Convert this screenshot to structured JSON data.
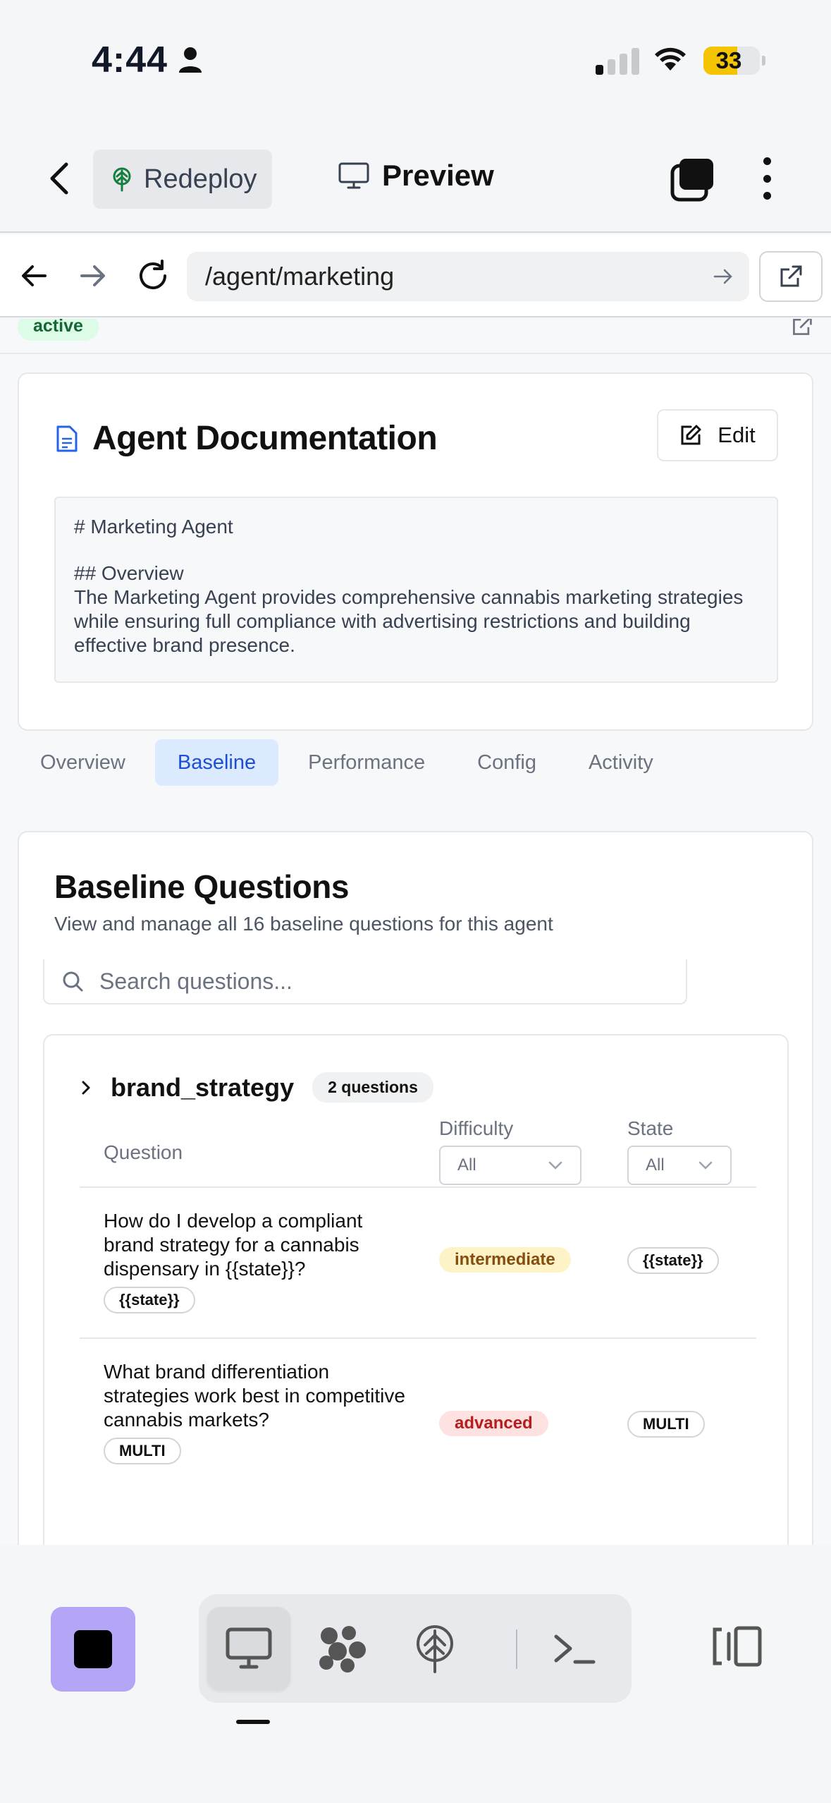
{
  "status_bar": {
    "time": "4:44",
    "battery": "33"
  },
  "app_header": {
    "redeploy_label": "Redeploy",
    "preview_label": "Preview"
  },
  "browser": {
    "url": "/agent/marketing"
  },
  "agent": {
    "status_badge": "active"
  },
  "documentation": {
    "title": "Agent Documentation",
    "edit_label": "Edit",
    "line1": "# Marketing Agent",
    "line2": "## Overview",
    "line3": "The Marketing Agent provides comprehensive cannabis marketing strategies while ensuring full compliance with advertising restrictions and building effective brand presence."
  },
  "tabs": [
    {
      "label": "Overview"
    },
    {
      "label": "Baseline"
    },
    {
      "label": "Performance"
    },
    {
      "label": "Config"
    },
    {
      "label": "Activity"
    }
  ],
  "active_tab": "Baseline",
  "baseline": {
    "title": "Baseline Questions",
    "subtitle": "View and manage all 16 baseline questions for this agent",
    "search_placeholder": "Search questions...",
    "group": {
      "name": "brand_strategy",
      "count_label": "2 questions",
      "columns": {
        "question": "Question",
        "difficulty": "Difficulty",
        "state": "State"
      },
      "filters": {
        "difficulty": "All",
        "state": "All"
      },
      "rows": [
        {
          "question": "How do I develop a compliant brand strategy for a cannabis dispensary in {{state}}?",
          "tag": "{{state}}",
          "difficulty": "intermediate",
          "state": "{{state}}"
        },
        {
          "question": "What brand differentiation strategies work best in competitive cannabis markets?",
          "tag": "MULTI",
          "difficulty": "advanced",
          "state": "MULTI"
        }
      ]
    }
  },
  "colors": {
    "accent_tab_bg": "#dbeafe",
    "accent_tab_text": "#1d4ed8",
    "intermediate_bg": "#fef3c7",
    "advanced_bg": "#fee2e2",
    "active_badge_bg": "#dcfce7",
    "stop_button": "#b4a5f7",
    "battery": "#f5c400"
  },
  "icons": [
    "person-icon",
    "signal-icon",
    "wifi-icon",
    "back-chevron-icon",
    "deploy-tree-icon",
    "monitor-icon",
    "layers-icon",
    "more-vertical-icon",
    "arrow-left-icon",
    "arrow-right-icon",
    "reload-icon",
    "external-link-icon",
    "document-icon",
    "edit-icon",
    "search-icon",
    "chevron-right-icon",
    "chevron-down-icon",
    "stop-icon",
    "agents-icon",
    "terminal-icon",
    "panel-toggle-icon"
  ]
}
